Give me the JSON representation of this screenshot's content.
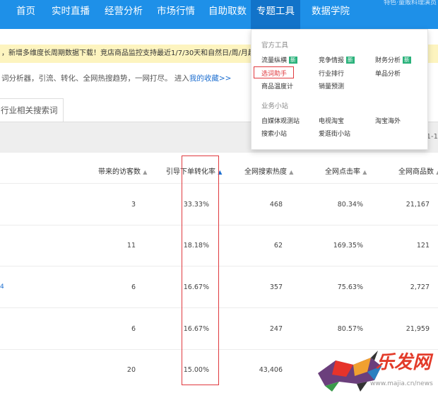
{
  "nav": {
    "items": [
      "首页",
      "实时直播",
      "经营分析",
      "市场行情",
      "自助取数",
      "专题工具",
      "数据学院"
    ],
    "active_index": 5,
    "right_text": "特色·量贩料理演员"
  },
  "notice": {
    "text": "，新增多维度长周期数据下载！竞店商品监控支持最近1/7/30天和自然日/周/月超强丰富维"
  },
  "description": {
    "text": "词分析器，引流、转化、全网热搜趋势，一网打尽。 进入",
    "link": "我的收藏>>"
  },
  "tab": {
    "label": "行业相关搜索词"
  },
  "pagination": {
    "text": "1-1"
  },
  "table": {
    "headers": [
      "带来的访客数",
      "引导下单转化率",
      "全网搜索热度",
      "全网点击率",
      "全网商品数"
    ],
    "rows": [
      [
        "3",
        "33.33%",
        "468",
        "80.34%",
        "21,167"
      ],
      [
        "11",
        "18.18%",
        "62",
        "169.35%",
        "121"
      ],
      [
        "6",
        "16.67%",
        "357",
        "75.63%",
        "2,727"
      ],
      [
        "6",
        "16.67%",
        "247",
        "80.57%",
        "21,959"
      ],
      [
        "20",
        "15.00%",
        "43,406",
        "",
        ""
      ]
    ],
    "row3_mark": "4"
  },
  "dropdown": {
    "section1_title": "官方工具",
    "section1_items": [
      {
        "label": "流量纵横",
        "badge": "新"
      },
      {
        "label": "竞争情报",
        "badge": "新"
      },
      {
        "label": "财务分析",
        "badge": "新"
      },
      {
        "label": "选词助手",
        "badge": ""
      },
      {
        "label": "行业排行",
        "badge": ""
      },
      {
        "label": "单品分析",
        "badge": ""
      },
      {
        "label": "商品温度计",
        "badge": ""
      },
      {
        "label": "销量预测",
        "badge": ""
      }
    ],
    "section2_title": "业务小站",
    "section2_items": [
      {
        "label": "自媒体观测站"
      },
      {
        "label": "电视淘宝"
      },
      {
        "label": "淘宝海外"
      },
      {
        "label": "搜索小站"
      },
      {
        "label": "爱逛街小站"
      }
    ]
  },
  "watermark": {
    "text": "乐发网",
    "url": "www.majia.cn/news"
  },
  "colors": {
    "nav_bg": "#1e90e8",
    "highlight": "#e0393e",
    "badge": "#2ab27b",
    "notice_bg": "#fdf4bf"
  }
}
